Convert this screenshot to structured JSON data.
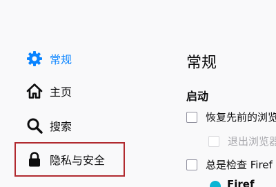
{
  "sidebar": {
    "items": [
      {
        "id": "general",
        "label": "常规",
        "icon": "gear-icon",
        "selected": true
      },
      {
        "id": "home",
        "label": "主页",
        "icon": "home-icon",
        "selected": false
      },
      {
        "id": "search",
        "label": "搜索",
        "icon": "search-icon",
        "selected": false
      },
      {
        "id": "privacy",
        "label": "隐私与安全",
        "icon": "lock-icon",
        "selected": false
      }
    ]
  },
  "main": {
    "title": "常规",
    "startup": {
      "heading": "启动",
      "restore_session_label": "恢复先前的浏览",
      "warn_quit_label": "退出浏览器",
      "check_default_label": "总是检查 Firef",
      "partial_row_label": "Firef"
    }
  },
  "colors": {
    "accent": "#0a84ff",
    "highlight_border": "#b12a2f",
    "background": "#f9f9fa"
  }
}
